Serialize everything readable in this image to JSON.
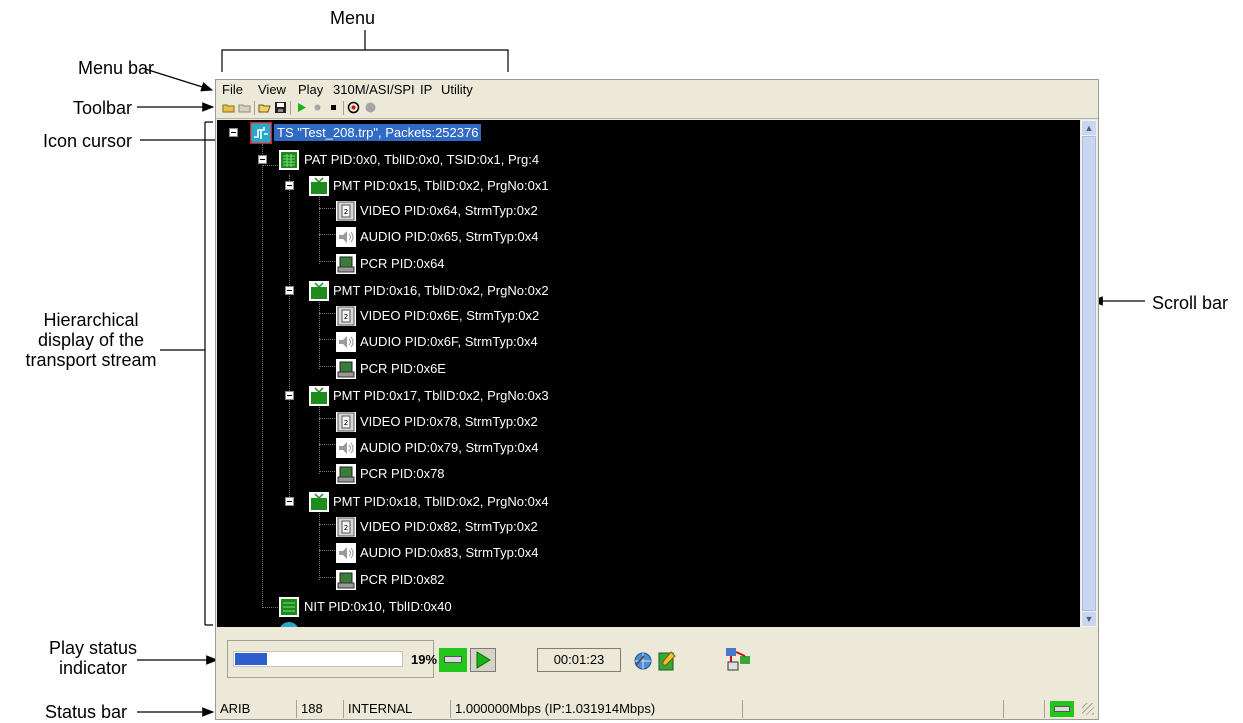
{
  "callouts": {
    "menu": "Menu",
    "menu_bar": "Menu bar",
    "toolbar": "Toolbar",
    "icon_cursor": "Icon cursor",
    "hierarchy_1": "Hierarchical",
    "hierarchy_2": "display of the",
    "hierarchy_3": "transport stream",
    "scroll_bar": "Scroll bar",
    "play_status_1": "Play status",
    "play_status_2": "indicator",
    "status_bar": "Status bar"
  },
  "menubar": {
    "items": [
      "File",
      "View",
      "Play",
      "310M/ASI/SPI",
      "IP",
      "Utility"
    ]
  },
  "toolbar": {
    "icons": [
      "open-folder-icon",
      "folder-icon",
      "open-file-icon",
      "save-icon",
      "play-icon",
      "record-icon",
      "stop-icon",
      "loop-icon",
      "pause-icon"
    ]
  },
  "tree": {
    "root": "TS \"Test_208.trp\", Packets:252376",
    "pat": "PAT PID:0x0, TblID:0x0, TSID:0x1, Prg:4",
    "programs": [
      {
        "pmt": "PMT PID:0x15, TblID:0x2, PrgNo:0x1",
        "video": "VIDEO PID:0x64, StrmTyp:0x2",
        "audio": "AUDIO PID:0x65, StrmTyp:0x4",
        "pcr": "PCR PID:0x64"
      },
      {
        "pmt": "PMT PID:0x16, TblID:0x2, PrgNo:0x2",
        "video": "VIDEO PID:0x6E, StrmTyp:0x2",
        "audio": "AUDIO PID:0x6F, StrmTyp:0x4",
        "pcr": "PCR PID:0x6E"
      },
      {
        "pmt": "PMT PID:0x17, TblID:0x2, PrgNo:0x3",
        "video": "VIDEO PID:0x78, StrmTyp:0x2",
        "audio": "AUDIO PID:0x79, StrmTyp:0x4",
        "pcr": "PCR PID:0x78"
      },
      {
        "pmt": "PMT PID:0x18, TblID:0x2, PrgNo:0x4",
        "video": "VIDEO PID:0x82, StrmTyp:0x2",
        "audio": "AUDIO PID:0x83, StrmTyp:0x4",
        "pcr": "PCR PID:0x82"
      }
    ],
    "nit": "NIT PID:0x10, TblID:0x40"
  },
  "play": {
    "progress_percent": 19,
    "progress_label": "19%",
    "time": "00:01:23"
  },
  "statusbar": {
    "standard": "ARIB",
    "packet_size": "188",
    "clock": "INTERNAL",
    "rate": "1.000000Mbps (IP:1.031914Mbps)"
  },
  "colors": {
    "tree_background": "#000000",
    "selection": "#316ac5",
    "progress_fill": "#2f5fce",
    "green_indicator": "#22c51a"
  }
}
